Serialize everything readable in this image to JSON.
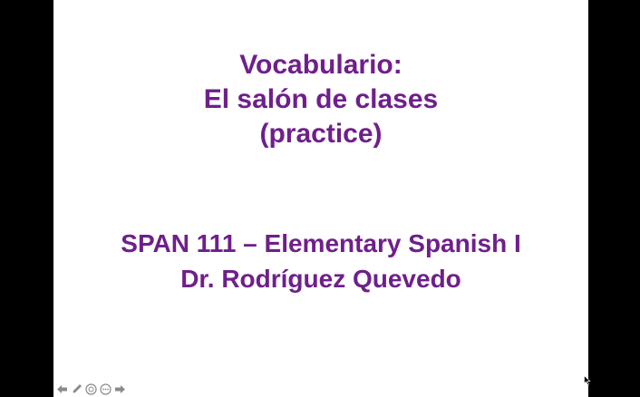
{
  "slide": {
    "title_lines": [
      "Vocabulario:",
      "El salón de clases",
      "(practice)"
    ],
    "subtitle_lines": [
      "SPAN 111 – Elementary Spanish I",
      "Dr. Rodríguez Quevedo"
    ]
  },
  "colors": {
    "text": "#6f1f8b",
    "slide_background": "#ffffff",
    "letterbox": "#000000",
    "control_icons": "#8a8a8a"
  },
  "controls": {
    "icons": [
      "previous-arrow-icon",
      "pen-icon",
      "zoom-icon",
      "more-options-icon",
      "next-arrow-icon"
    ]
  }
}
